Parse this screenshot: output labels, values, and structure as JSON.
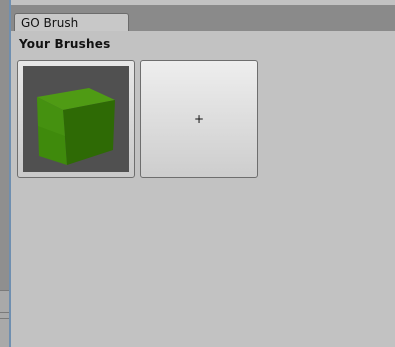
{
  "window": {
    "tab_label": "GO Brush"
  },
  "brushes_section": {
    "title": "Your Brushes",
    "brushes": [
      {
        "thumbnail_icon": "green-cube-icon",
        "cube_color": "#4b9a12"
      }
    ],
    "add_button_label": "+"
  }
}
